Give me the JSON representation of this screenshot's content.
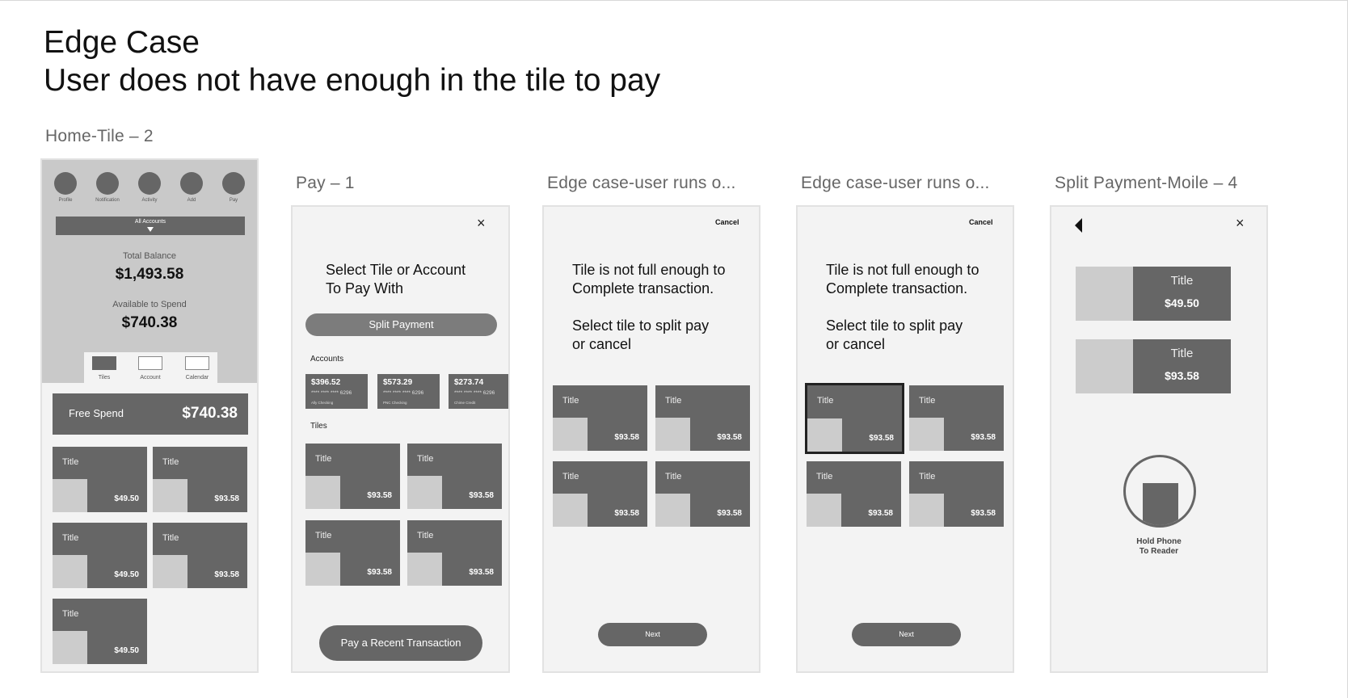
{
  "header": {
    "title_line1": "Edge Case",
    "title_line2": "User does not have enough in the tile to pay"
  },
  "artboards": {
    "home": {
      "label": "Home-Tile – 2",
      "nav": [
        "Profile",
        "Notification",
        "Activity",
        "Add",
        "Pay"
      ],
      "accounts_dropdown": "All Accounts",
      "total_balance_label": "Total Balance",
      "total_balance": "$1,493.58",
      "available_label": "Available to Spend",
      "available": "$740.38",
      "view_tabs": [
        "Tiles",
        "Account",
        "Calendar"
      ],
      "free_spend_label": "Free Spend",
      "free_spend_value": "$740.38",
      "tiles": [
        {
          "title": "Title",
          "value": "$49.50"
        },
        {
          "title": "Title",
          "value": "$93.58"
        },
        {
          "title": "Title",
          "value": "$49.50"
        },
        {
          "title": "Title",
          "value": "$93.58"
        },
        {
          "title": "Title",
          "value": "$49.50"
        }
      ]
    },
    "pay": {
      "label": "Pay – 1",
      "close": "×",
      "heading_line1": "Select Tile or Account",
      "heading_line2": "To Pay With",
      "split_button": "Split Payment",
      "accounts_heading": "Accounts",
      "accounts": [
        {
          "balance": "$396.52",
          "number": "**** **** **** 6296",
          "name": "Ally Checking"
        },
        {
          "balance": "$573.29",
          "number": "**** **** **** 6296",
          "name": "PNC Checking"
        },
        {
          "balance": "$273.74",
          "number": "**** **** **** 6296",
          "name": "Chime Credit"
        }
      ],
      "tiles_heading": "Tiles",
      "tiles": [
        {
          "title": "Title",
          "value": "$93.58"
        },
        {
          "title": "Title",
          "value": "$93.58"
        },
        {
          "title": "Title",
          "value": "$93.58"
        },
        {
          "title": "Title",
          "value": "$93.58"
        }
      ],
      "recent_button": "Pay a Recent Transaction"
    },
    "edge1": {
      "label": "Edge case-user runs o...",
      "cancel": "Cancel",
      "msg_line1": "Tile is not full enough to",
      "msg_line2": "Complete transaction.",
      "msg_line3": "Select tile to split pay",
      "msg_line4": "or cancel",
      "tiles": [
        {
          "title": "Title",
          "value": "$93.58"
        },
        {
          "title": "Title",
          "value": "$93.58"
        },
        {
          "title": "Title",
          "value": "$93.58"
        },
        {
          "title": "Title",
          "value": "$93.58"
        }
      ],
      "next": "Next"
    },
    "edge2": {
      "label": "Edge case-user runs o...",
      "cancel": "Cancel",
      "msg_line1": "Tile is not full enough to",
      "msg_line2": "Complete transaction.",
      "msg_line3": "Select tile to split pay",
      "msg_line4": "or cancel",
      "tiles": [
        {
          "title": "Title",
          "value": "$93.58"
        },
        {
          "title": "Title",
          "value": "$93.58"
        },
        {
          "title": "Title",
          "value": "$93.58"
        },
        {
          "title": "Title",
          "value": "$93.58"
        }
      ],
      "next": "Next"
    },
    "split": {
      "label": "Split Payment-Moile – 4",
      "close": "×",
      "tiles": [
        {
          "title": "Title",
          "value": "$49.50"
        },
        {
          "title": "Title",
          "value": "$93.58"
        }
      ],
      "hold_line1": "Hold Phone",
      "hold_line2": "To Reader"
    }
  }
}
